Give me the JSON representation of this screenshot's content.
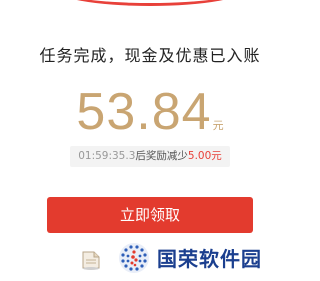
{
  "headline": "任务完成，现金及优惠已入账",
  "reward": {
    "amount": "53.84",
    "unit": "元"
  },
  "countdown": {
    "time": "01:59:35.3",
    "middle": "后奖励减少",
    "reduction": "5.00元"
  },
  "claim_button_label": "立即领取",
  "watermark": {
    "brand": "国荣软件园"
  },
  "colors": {
    "accent_red": "#e33b2e",
    "amount_gold": "#c9a572",
    "brand_blue": "#1b3f8f"
  }
}
